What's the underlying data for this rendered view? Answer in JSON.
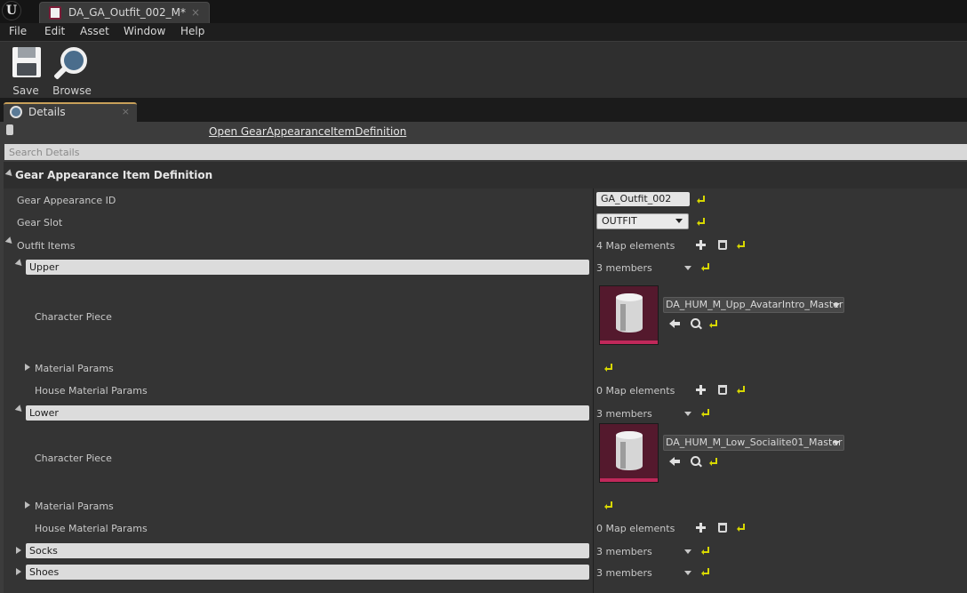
{
  "app": {
    "logo": "U"
  },
  "doc_tab": {
    "label": "DA_GA_Outfit_002_M*",
    "close": "×"
  },
  "menu": [
    "File",
    "Edit",
    "Asset",
    "Window",
    "Help"
  ],
  "toolbar": {
    "save_label": "Save",
    "browse_label": "Browse"
  },
  "details_tab": {
    "label": "Details",
    "close": "×"
  },
  "details": {
    "open_link": "Open GearAppearanceItemDefinition",
    "search_placeholder": "Search Details",
    "category": "Gear Appearance Item Definition",
    "gear_appearance_id": {
      "label": "Gear Appearance ID",
      "value": "GA_Outfit_002"
    },
    "gear_slot": {
      "label": "Gear Slot",
      "value": "OUTFIT"
    },
    "outfit_items": {
      "label": "Outfit Items",
      "value": "4 Map elements"
    },
    "entries": [
      {
        "key": "Upper",
        "members": "3 members",
        "character_piece_label": "Character Piece",
        "character_piece_value": "DA_HUM_M_Upp_AvatarIntro_Master",
        "material_params_label": "Material Params",
        "house_material_params_label": "House Material Params",
        "house_material_params_value": "0 Map elements"
      },
      {
        "key": "Lower",
        "members": "3 members",
        "character_piece_label": "Character Piece",
        "character_piece_value": "DA_HUM_M_Low_Socialite01_Master",
        "material_params_label": "Material Params",
        "house_material_params_label": "House Material Params",
        "house_material_params_value": "0 Map elements"
      },
      {
        "key": "Socks",
        "members": "3 members"
      },
      {
        "key": "Shoes",
        "members": "3 members"
      }
    ]
  },
  "icons": {
    "logo": "unreal-logo-icon",
    "asset": "data-asset-icon",
    "save": "floppy-disk-icon",
    "browse": "magnifier-icon",
    "reset": "reset-to-default-icon",
    "add": "plus-icon",
    "delete": "trash-icon",
    "use": "use-selected-arrow-icon",
    "find": "find-in-browser-icon",
    "lock": "lock-icon"
  },
  "colors": {
    "accent_tab": "#c8a05a",
    "asset_thumbnail": "#54192d",
    "asset_bar": "#c0285a",
    "reset_icon": "#d8d800"
  }
}
